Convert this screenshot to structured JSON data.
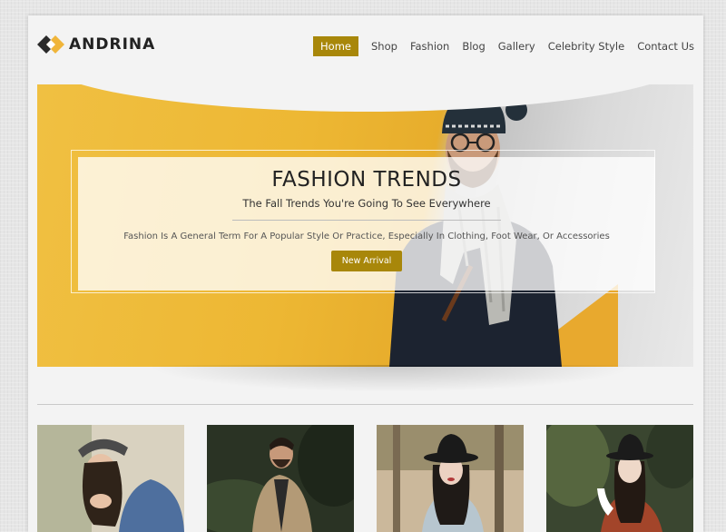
{
  "brand": {
    "name": "ANDRINA"
  },
  "nav": {
    "items": [
      {
        "label": "Home",
        "active": true
      },
      {
        "label": "Shop",
        "active": false
      },
      {
        "label": "Fashion",
        "active": false
      },
      {
        "label": "Blog",
        "active": false
      },
      {
        "label": "Gallery",
        "active": false
      },
      {
        "label": "Celebrity Style",
        "active": false
      },
      {
        "label": "Contact Us",
        "active": false
      }
    ]
  },
  "hero": {
    "title": "FASHION TRENDS",
    "subtitle": "The Fall Trends You're Going To See Everywhere",
    "description": "Fashion Is A General Term For A Popular Style Or Practice, Especially In Clothing, Foot Wear, Or Accessories",
    "button_label": "New Arrival"
  },
  "colors": {
    "accent": "#a8870a",
    "hero_yellow": "#edb733",
    "page_bg": "#f3f3f3"
  },
  "products": [
    {
      "image": "woman-in-hat-smiling"
    },
    {
      "image": "man-in-beige-jacket"
    },
    {
      "image": "woman-in-black-hat"
    },
    {
      "image": "woman-in-red-coat"
    }
  ]
}
